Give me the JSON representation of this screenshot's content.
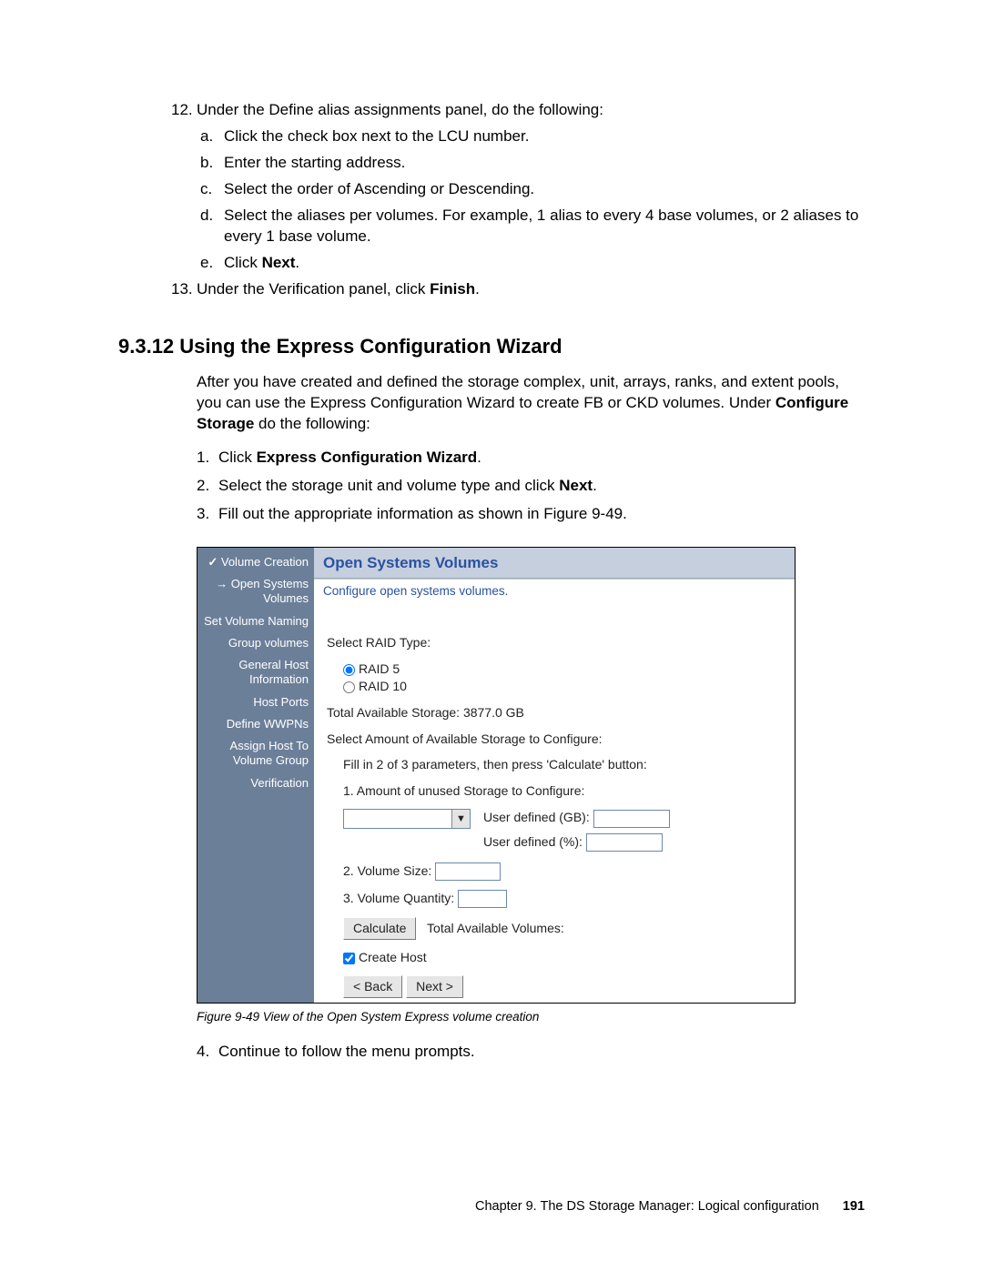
{
  "step12": {
    "num": "12.",
    "text_a": "Under the Define alias assignments panel, do the following:",
    "sub": [
      {
        "num": "a.",
        "text": "Click the check box next to the LCU number."
      },
      {
        "num": "b.",
        "text": "Enter the starting address."
      },
      {
        "num": "c.",
        "text": "Select the order of Ascending or Descending."
      },
      {
        "num": "d.",
        "text": "Select the aliases per volumes. For example, 1 alias to every 4 base volumes, or 2 aliases to every 1 base volume."
      },
      {
        "num": "e.",
        "text_pre": "Click ",
        "bold": "Next",
        "post": "."
      }
    ]
  },
  "step13": {
    "num": "13.",
    "text_pre": "Under the Verification panel, click ",
    "bold": "Finish",
    "post": "."
  },
  "heading": "9.3.12  Using the Express Configuration Wizard",
  "para1_pre": "After you have created and defined the storage complex, unit, arrays, ranks, and extent pools, you can use the Express Configuration Wizard to create FB or CKD volumes. Under ",
  "para1_bold": "Configure Storage",
  "para1_post": " do the following:",
  "list2": {
    "i1": {
      "num": "1.",
      "pre": "Click ",
      "bold": "Express Configuration Wizard",
      "post": "."
    },
    "i2": {
      "num": "2.",
      "pre": "Select the storage unit and volume type and click ",
      "bold": "Next",
      "post": "."
    },
    "i3": {
      "num": "3.",
      "text": "Fill out the appropriate information as shown in Figure 9-49."
    },
    "i4": {
      "num": "4.",
      "text": "Continue to follow the menu prompts."
    }
  },
  "wizard": {
    "side": {
      "s1": "Volume Creation",
      "s2": "Open Systems Volumes",
      "s3": "Set Volume Naming",
      "s4": "Group volumes",
      "s5": "General Host Information",
      "s6": "Host Ports",
      "s7": "Define WWPNs",
      "s8": "Assign Host To Volume Group",
      "s9": "Verification"
    },
    "title": "Open Systems Volumes",
    "subtitle": "Configure open systems volumes.",
    "raid_label": "Select RAID Type:",
    "raid5": "RAID 5",
    "raid10": "RAID 10",
    "total_storage": "Total Available Storage: 3877.0 GB",
    "sel_amount": "Select Amount of Available Storage to Configure:",
    "fill_hint": "Fill in 2 of 3 parameters, then press 'Calculate' button:",
    "p1": "1. Amount of unused Storage to Configure:",
    "ud_gb": "User defined (GB):",
    "ud_pct": "User defined (%):",
    "p2": "2. Volume Size:",
    "p3": "3. Volume Quantity:",
    "calc": "Calculate",
    "tot_vol": "Total Available Volumes:",
    "create_host": "Create Host",
    "back": "< Back",
    "next": "Next >"
  },
  "caption": "Figure 9-49   View of the Open System Express volume creation",
  "footer": {
    "chapter": "Chapter 9. The DS Storage Manager: Logical configuration",
    "page": "191"
  }
}
